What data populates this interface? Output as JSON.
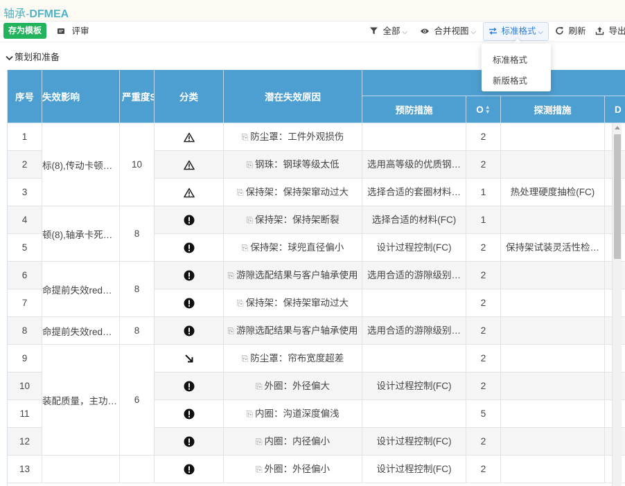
{
  "title": {
    "prefix": "轴承-",
    "suffix": "DFMEA"
  },
  "toolbar": {
    "save_template": "存为模板",
    "review": "评审",
    "filter_all": "全部",
    "merge_view": "合并视图",
    "format": "标准格式",
    "refresh": "刷新",
    "export": "导出"
  },
  "format_menu": {
    "options": [
      "标准格式",
      "新版格式"
    ]
  },
  "section": {
    "label": "策划和准备"
  },
  "table": {
    "headers": {
      "seq": "序号",
      "effect": "失效影响",
      "severity": "严重度S",
      "category": "分类",
      "cause": "潜在失效原因",
      "prevention": "预防措施",
      "occurrence": "O",
      "detection": "探测措施",
      "d": "D"
    },
    "effect_groups": [
      {
        "rows": [
          1,
          3
        ],
        "effect": "标(8),传动卡顿…",
        "severity": "10"
      },
      {
        "rows": [
          4,
          5
        ],
        "effect": "顿(8),轴承卡死…",
        "severity": "8"
      },
      {
        "rows": [
          6,
          7
        ],
        "effect": "命提前失效red…",
        "severity": "8"
      },
      {
        "rows": [
          8,
          8
        ],
        "effect": "命提前失效red…",
        "severity": "8"
      },
      {
        "rows": [
          9,
          12
        ],
        "effect": "装配质量，主功…",
        "severity": "6"
      },
      {
        "rows": [
          13,
          13
        ],
        "effect": "",
        "severity": ""
      }
    ],
    "rows": [
      {
        "seq": "1",
        "cls": "warning-icon",
        "cause": "防尘罩：工件外观损伤",
        "prevention": "",
        "o": "2",
        "detection": ""
      },
      {
        "seq": "2",
        "cls": "warning-icon",
        "cause": "钢珠：钢球等级太低",
        "prevention": "选用高等级的优质钢…",
        "o": "2",
        "detection": ""
      },
      {
        "seq": "3",
        "cls": "warning-icon",
        "cause": "保持架：保持架窜动过大",
        "prevention": "选择合适的套圈材料…",
        "o": "1",
        "detection": "热处理硬度抽检(FC)"
      },
      {
        "seq": "4",
        "cls": "exclamation-icon",
        "cause": "保持架：保持架断裂",
        "prevention": "选择合适的材料(FC)",
        "o": "1",
        "detection": ""
      },
      {
        "seq": "5",
        "cls": "exclamation-icon",
        "cause": "保持架：球兜直径偏小",
        "prevention": "设计过程控制(FC)",
        "o": "2",
        "detection": "保持架试装灵活性检…"
      },
      {
        "seq": "6",
        "cls": "exclamation-icon",
        "cause": "游隙选配结果与客户轴承使用",
        "prevention": "选用合适的游隙级别…",
        "o": "2",
        "detection": ""
      },
      {
        "seq": "7",
        "cls": "exclamation-icon",
        "cause": "保持架：保持架窜动过大",
        "prevention": "",
        "o": "2",
        "detection": ""
      },
      {
        "seq": "8",
        "cls": "exclamation-icon",
        "cause": "游隙选配结果与客户轴承使用",
        "prevention": "选用合适的游隙级别…",
        "o": "2",
        "detection": ""
      },
      {
        "seq": "9",
        "cls": "arrow-down-right-icon",
        "cause": "防尘罩：帘布宽度超差",
        "prevention": "",
        "o": "2",
        "detection": ""
      },
      {
        "seq": "10",
        "cls": "exclamation-icon",
        "cause": "外圈：外径偏大",
        "prevention": "设计过程控制(FC)",
        "o": "2",
        "detection": ""
      },
      {
        "seq": "11",
        "cls": "exclamation-icon",
        "cause": "内圈：沟道深度偏浅",
        "prevention": "",
        "o": "5",
        "detection": ""
      },
      {
        "seq": "12",
        "cls": "exclamation-icon",
        "cause": "内圈：内径偏小",
        "prevention": "设计过程控制(FC)",
        "o": "2",
        "detection": ""
      },
      {
        "seq": "13",
        "cls": "exclamation-icon",
        "cause": "外圈：外径偏小",
        "prevention": "设计过程控制(FC)",
        "o": "2",
        "detection": ""
      }
    ]
  },
  "colors": {
    "header_bg": "#4e9fd1",
    "accent": "#2f7fd6",
    "title": "#4fb3c4",
    "save_button": "#21b45c"
  }
}
